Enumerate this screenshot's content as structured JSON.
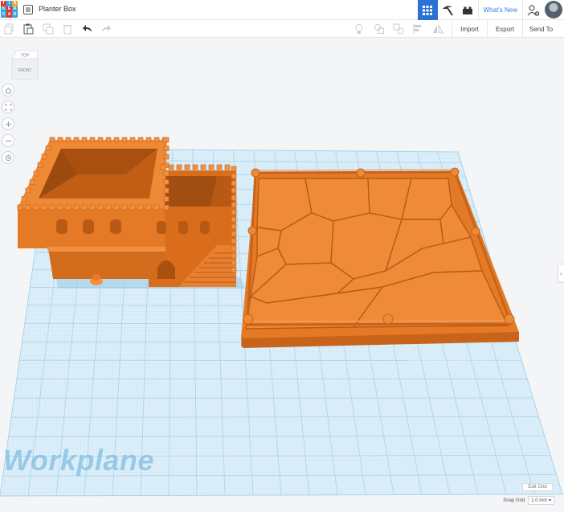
{
  "app": {
    "logo_letters": [
      "T",
      "I",
      "N",
      "K",
      "E",
      "R",
      "C",
      "A",
      "D"
    ],
    "logo_colors": [
      "#e0382f",
      "#3aa3dd",
      "#f2a52c",
      "#3aa3dd",
      "#e0382f",
      "#3aa3dd",
      "#3aa3dd",
      "#e0382f",
      "#3aa3dd"
    ],
    "title": "Planter Box"
  },
  "header": {
    "whats_new": "What's New"
  },
  "toolbar": {
    "import_label": "Import",
    "export_label": "Export",
    "send_to_label": "Send To"
  },
  "viewcube": {
    "top_label": "TOP",
    "front_label": "FRONT"
  },
  "workplane": {
    "label": "Workplane",
    "edit_grid_label": "Edit Grid",
    "snap_grid_label": "Snap Grid",
    "snap_grid_value": "1.0 mm"
  },
  "colors": {
    "accent": "#2a72d6",
    "object": "#e87a22",
    "grid_line": "#b9dcef",
    "workplane_fill": "#d8edf8"
  }
}
